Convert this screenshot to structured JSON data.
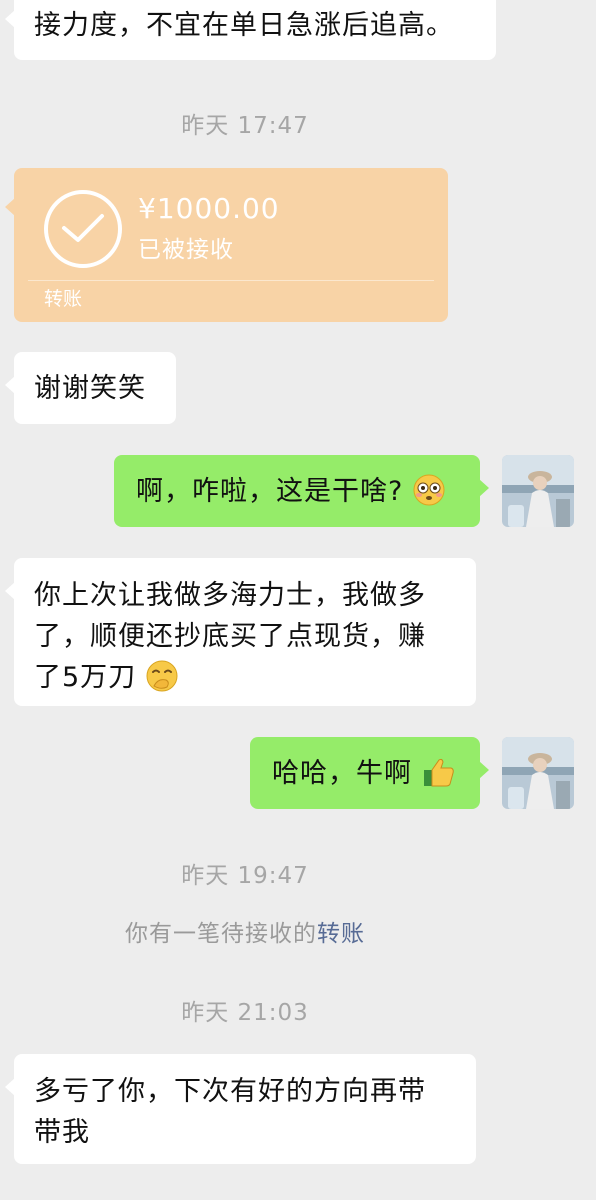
{
  "messages": {
    "m1": {
      "text": "接力度，不宜在单日急涨后追高。"
    },
    "ts1": "昨天 17:47",
    "transfer": {
      "amount": "¥1000.00",
      "status": "已被接收",
      "label": "转账"
    },
    "m2": {
      "text": "谢谢笑笑"
    },
    "m3": {
      "text": "啊，咋啦，这是干啥?",
      "emoji": "flushed-face"
    },
    "m4": {
      "line1": "你上次让我做多海力士，我做多",
      "line2": "了，顺便还抄底买了点现货，赚",
      "line3": "了5万刀",
      "emoji": "hand-over-mouth-face"
    },
    "m5": {
      "text": "哈哈，牛啊",
      "emoji": "thumbs-up"
    },
    "ts2": "昨天 19:47",
    "system": {
      "prefix": "你有一笔待接收的",
      "link": "转账"
    },
    "ts3": "昨天 21:03",
    "m6": {
      "line1": "多亏了你，下次有好的方向再带",
      "line2": "带我"
    }
  },
  "colors": {
    "background": "#ededed",
    "left_bubble": "#ffffff",
    "right_bubble": "#95ec69",
    "transfer_card": "#f8d3a6",
    "link": "#576b95"
  }
}
